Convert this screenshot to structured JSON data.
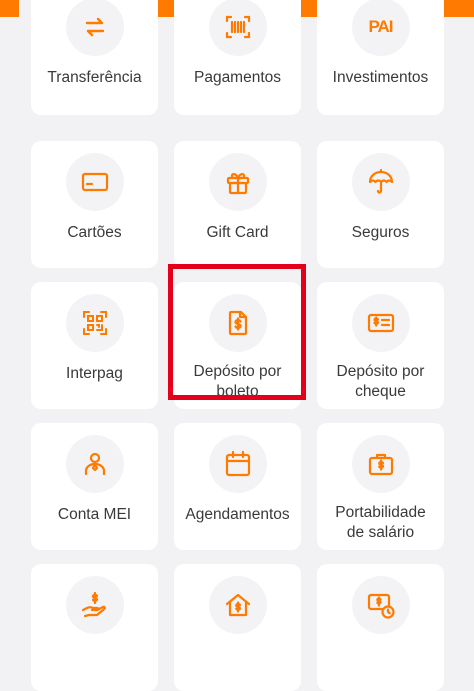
{
  "colors": {
    "accent": "#ff7a00",
    "highlight": "#e3001b",
    "tile": "#ffffff",
    "background": "#f2f2f5"
  },
  "tiles": [
    {
      "label": "Transferência",
      "icon": "transfer-arrows-icon"
    },
    {
      "label": "Pagamentos",
      "icon": "barcode-scan-icon"
    },
    {
      "label": "Investimentos",
      "icon": "pai-logo-icon",
      "logo_text": "PAI"
    },
    {
      "label": "Cartões",
      "icon": "card-icon"
    },
    {
      "label": "Gift Card",
      "icon": "gift-icon"
    },
    {
      "label": "Seguros",
      "icon": "umbrella-icon"
    },
    {
      "label": "Interpag",
      "icon": "qr-code-icon"
    },
    {
      "label": "Depósito por boleto",
      "icon": "boleto-document-icon"
    },
    {
      "label": "Depósito por cheque",
      "icon": "cheque-icon"
    },
    {
      "label": "Conta MEI",
      "icon": "person-icon"
    },
    {
      "label": "Agendamentos",
      "icon": "calendar-icon"
    },
    {
      "label": "Portabilidade de salário",
      "icon": "briefcase-icon"
    },
    {
      "label": "",
      "icon": "hand-money-icon"
    },
    {
      "label": "",
      "icon": "house-money-icon"
    },
    {
      "label": "",
      "icon": "money-clock-icon"
    }
  ]
}
